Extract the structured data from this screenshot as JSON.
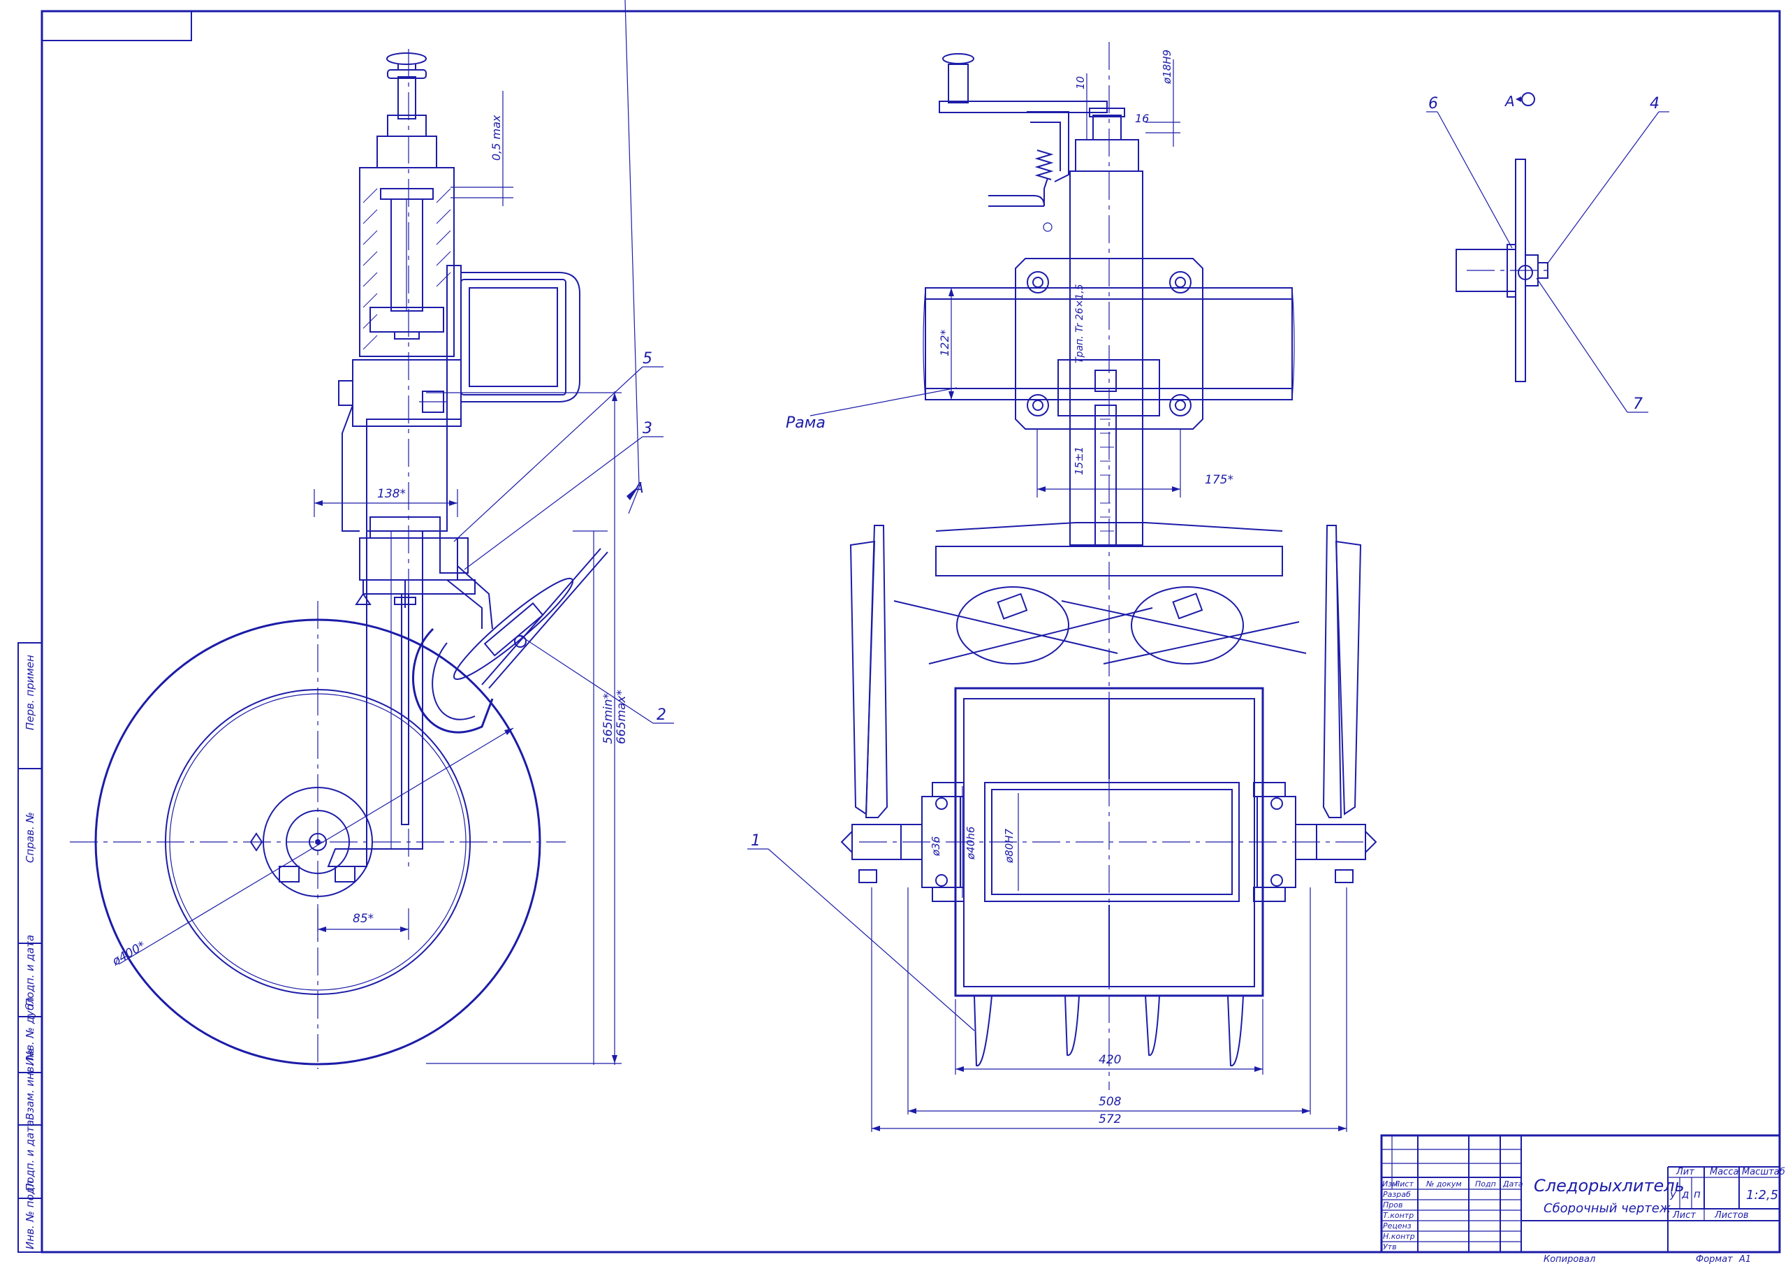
{
  "drawing": {
    "title": "Следорыхлитель",
    "subtitle": "Сборочный чертеж",
    "scale": "1:2,5",
    "format_label": "Формат",
    "format_value": "А1",
    "copied_label": "Копировал",
    "frame_label": "Рама",
    "view_label": "А"
  },
  "title_block": {
    "col_headers": [
      "Изм",
      "Лист",
      "№ докум",
      "Подп",
      "Дата"
    ],
    "row_labels": [
      "Разраб",
      "Пров",
      "Т.контр",
      "Реценз",
      "Н.контр",
      "Утв"
    ],
    "lit_header": "Лит",
    "mass_header": "Масса",
    "scale_header": "Масштаб",
    "lit_letters": [
      "у",
      "д",
      "п"
    ],
    "sheet_label": "Лист",
    "sheets_label": "Листов"
  },
  "side_stamps": [
    "Перв. примен",
    "Справ. №",
    "Подп. и дата",
    "Инв. № дубл",
    "Взам. инв. №",
    "Подп. и дата",
    "Инв. № подл"
  ],
  "leaders": [
    "1",
    "2",
    "3",
    "4",
    "5",
    "6",
    "7"
  ],
  "dimensions": {
    "q5max": "0,5 max",
    "d138": "138*",
    "d85": "85*",
    "d400": "ø400*",
    "d565": "565min*",
    "d665": "665max*",
    "d10": "10",
    "d16": "16",
    "d18": "ø18H9",
    "d122": "122*",
    "d175": "175*",
    "trap": "Трап. Tr 26×1,5",
    "scale_mark": "15±1",
    "d36": "ø36",
    "d40": "ø40h6",
    "d80": "ø80H7",
    "d420": "420",
    "d508": "508",
    "d572": "572"
  }
}
